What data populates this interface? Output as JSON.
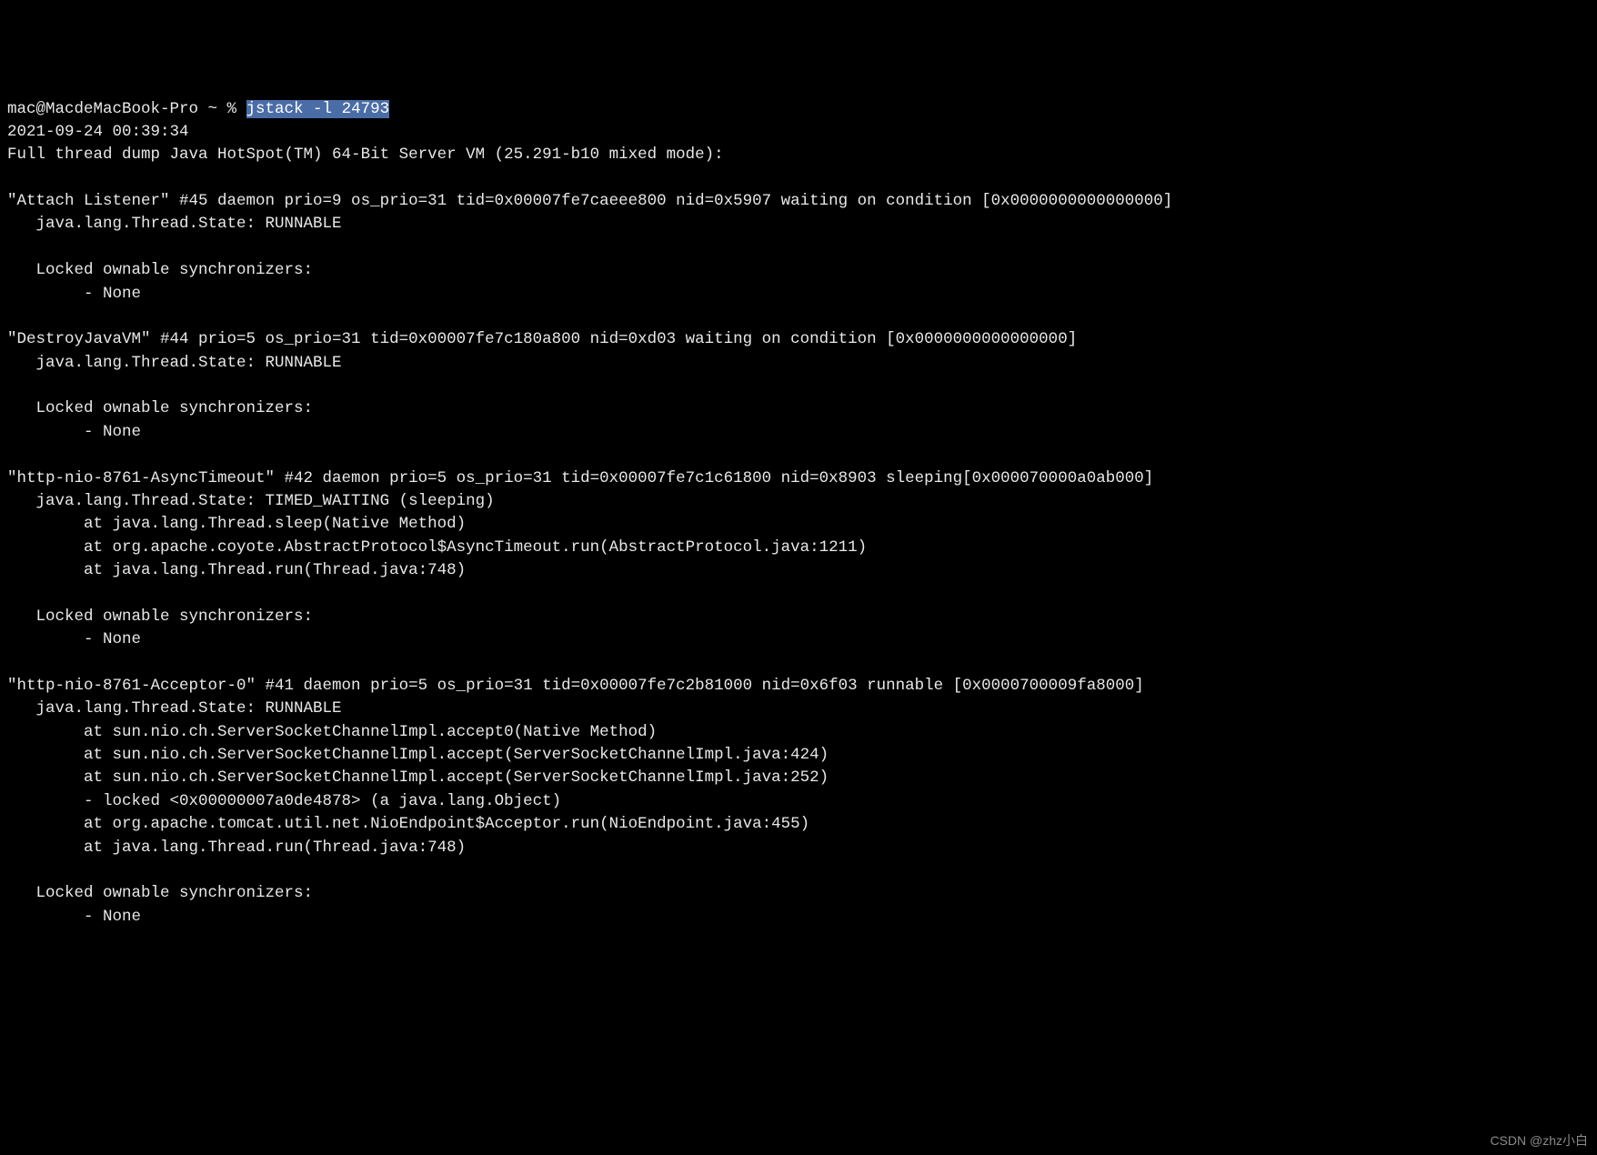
{
  "prompt_prefix": "mac@MacdeMacBook-Pro ~ % ",
  "command": "jstack -l 24793",
  "timestamp": "2021-09-24 00:39:34",
  "header": "Full thread dump Java HotSpot(TM) 64-Bit Server VM (25.291-b10 mixed mode):",
  "threads": [
    {
      "header": "\"Attach Listener\" #45 daemon prio=9 os_prio=31 tid=0x00007fe7caeee800 nid=0x5907 waiting on condition [0x0000000000000000]",
      "state": "   java.lang.Thread.State: RUNNABLE",
      "stack": [],
      "sync_header": "   Locked ownable synchronizers:",
      "sync_item": "        - None"
    },
    {
      "header": "\"DestroyJavaVM\" #44 prio=5 os_prio=31 tid=0x00007fe7c180a800 nid=0xd03 waiting on condition [0x0000000000000000]",
      "state": "   java.lang.Thread.State: RUNNABLE",
      "stack": [],
      "sync_header": "   Locked ownable synchronizers:",
      "sync_item": "        - None"
    },
    {
      "header": "\"http-nio-8761-AsyncTimeout\" #42 daemon prio=5 os_prio=31 tid=0x00007fe7c1c61800 nid=0x8903 sleeping[0x000070000a0ab000]",
      "state": "   java.lang.Thread.State: TIMED_WAITING (sleeping)",
      "stack": [
        "        at java.lang.Thread.sleep(Native Method)",
        "        at org.apache.coyote.AbstractProtocol$AsyncTimeout.run(AbstractProtocol.java:1211)",
        "        at java.lang.Thread.run(Thread.java:748)"
      ],
      "sync_header": "   Locked ownable synchronizers:",
      "sync_item": "        - None"
    },
    {
      "header": "\"http-nio-8761-Acceptor-0\" #41 daemon prio=5 os_prio=31 tid=0x00007fe7c2b81000 nid=0x6f03 runnable [0x0000700009fa8000]",
      "state": "   java.lang.Thread.State: RUNNABLE",
      "stack": [
        "        at sun.nio.ch.ServerSocketChannelImpl.accept0(Native Method)",
        "        at sun.nio.ch.ServerSocketChannelImpl.accept(ServerSocketChannelImpl.java:424)",
        "        at sun.nio.ch.ServerSocketChannelImpl.accept(ServerSocketChannelImpl.java:252)",
        "        - locked <0x00000007a0de4878> (a java.lang.Object)",
        "        at org.apache.tomcat.util.net.NioEndpoint$Acceptor.run(NioEndpoint.java:455)",
        "        at java.lang.Thread.run(Thread.java:748)"
      ],
      "sync_header": "   Locked ownable synchronizers:",
      "sync_item": "        - None"
    }
  ],
  "watermark": "CSDN @zhz小白"
}
